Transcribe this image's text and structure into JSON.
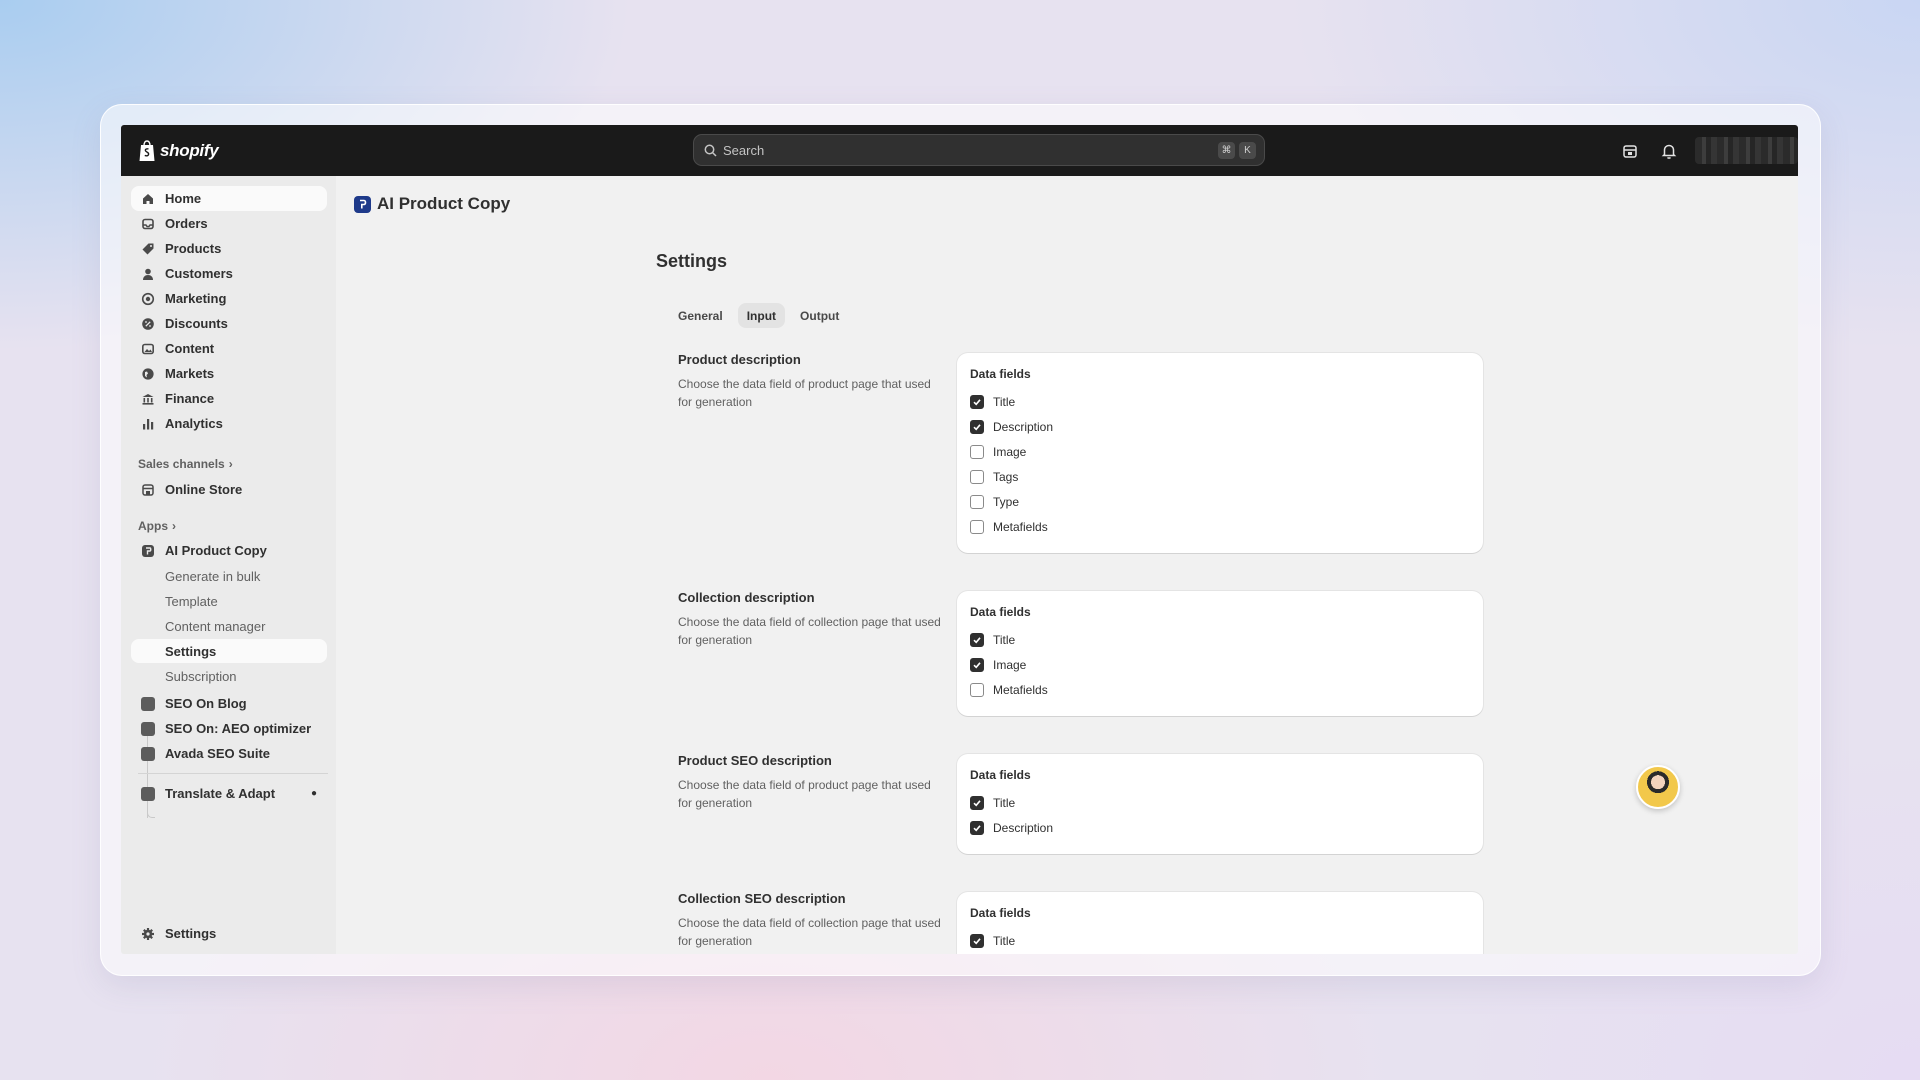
{
  "brand": {
    "name": "shopify"
  },
  "search": {
    "placeholder": "Search",
    "shortcut": [
      "⌘",
      "K"
    ]
  },
  "sidebar": {
    "main_items": [
      {
        "label": "Home",
        "icon": "home-icon"
      },
      {
        "label": "Orders",
        "icon": "inbox-icon"
      },
      {
        "label": "Products",
        "icon": "tag-icon"
      },
      {
        "label": "Customers",
        "icon": "person-icon"
      },
      {
        "label": "Marketing",
        "icon": "target-icon"
      },
      {
        "label": "Discounts",
        "icon": "discount-icon"
      },
      {
        "label": "Content",
        "icon": "image-icon"
      },
      {
        "label": "Markets",
        "icon": "globe-icon"
      },
      {
        "label": "Finance",
        "icon": "bank-icon"
      },
      {
        "label": "Analytics",
        "icon": "bar-chart-icon"
      }
    ],
    "sales_channels_label": "Sales channels",
    "online_store": "Online Store",
    "apps_label": "Apps",
    "app_name": "AI Product Copy",
    "app_sub_items": [
      "Generate in bulk",
      "Template",
      "Content manager",
      "Settings",
      "Subscription"
    ],
    "other_apps": [
      "SEO On Blog",
      "SEO On: AEO optimizer",
      "Avada SEO Suite"
    ],
    "translate_app": "Translate & Adapt",
    "settings": "Settings"
  },
  "main": {
    "app_title": "AI Product Copy",
    "page_title": "Settings",
    "tabs": [
      {
        "label": "General",
        "active": false
      },
      {
        "label": "Input",
        "active": true
      },
      {
        "label": "Output",
        "active": false
      }
    ],
    "sections": [
      {
        "title": "Product description",
        "desc": "Choose the data field of product page that used for generation",
        "card_title": "Data fields",
        "fields": [
          {
            "label": "Title",
            "checked": true
          },
          {
            "label": "Description",
            "checked": true
          },
          {
            "label": "Image",
            "checked": false
          },
          {
            "label": "Tags",
            "checked": false
          },
          {
            "label": "Type",
            "checked": false
          },
          {
            "label": "Metafields",
            "checked": false
          }
        ]
      },
      {
        "title": "Collection description",
        "desc": "Choose the data field of collection page that used for generation",
        "card_title": "Data fields",
        "fields": [
          {
            "label": "Title",
            "checked": true
          },
          {
            "label": "Image",
            "checked": true
          },
          {
            "label": "Metafields",
            "checked": false
          }
        ]
      },
      {
        "title": "Product SEO description",
        "desc": "Choose the data field of product page that used for generation",
        "card_title": "Data fields",
        "fields": [
          {
            "label": "Title",
            "checked": true
          },
          {
            "label": "Description",
            "checked": true
          }
        ]
      },
      {
        "title": "Collection SEO description",
        "desc": "Choose the data field of collection page that used for generation",
        "card_title": "Data fields",
        "fields": [
          {
            "label": "Title",
            "checked": true
          }
        ]
      }
    ]
  }
}
